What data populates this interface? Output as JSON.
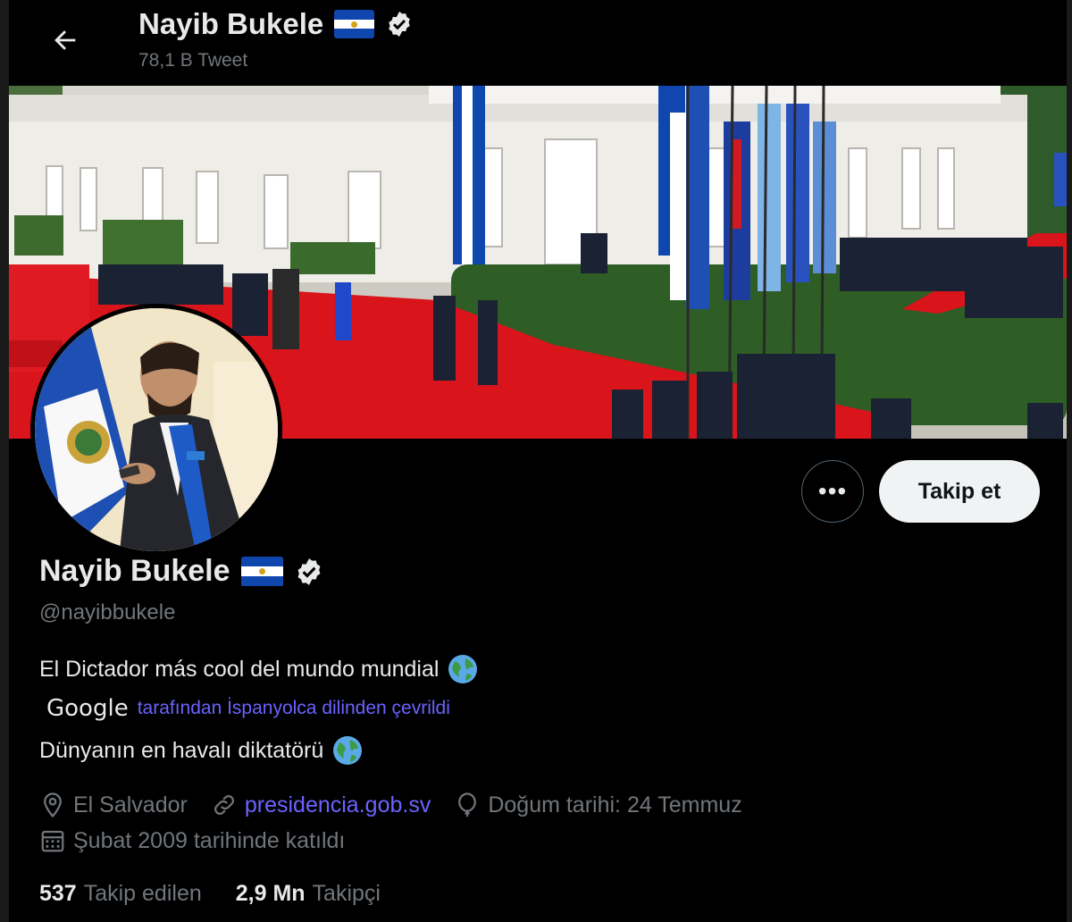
{
  "header": {
    "name": "Nayib Bukele",
    "tweet_count": "78,1 B Tweet"
  },
  "profile": {
    "name": "Nayib Bukele",
    "handle": "@nayibbukele",
    "bio": "El Dictador más cool del mundo mundial",
    "translation_brand": "Google",
    "translation_note": "tarafından İspanyolca dilinden çevrildi",
    "bio_translated": "Dünyanın en havalı diktatörü",
    "location": "El Salvador",
    "website": "presidencia.gob.sv",
    "birthday": "Doğum tarihi: 24 Temmuz",
    "joined": "Şubat 2009 tarihinde katıldı",
    "following_count": "537",
    "following_label": "Takip edilen",
    "followers_count": "2,9 Mn",
    "followers_label": "Takipçi"
  },
  "actions": {
    "more_label": "•••",
    "follow_label": "Takip et"
  },
  "colors": {
    "background": "#000000",
    "text_primary": "#e7e9ea",
    "text_secondary": "#71767b",
    "link": "#6b63ff",
    "follow_button_bg": "#eff3f4"
  },
  "icons": [
    "back-arrow-icon",
    "verified-badge-icon",
    "el-salvador-flag-icon",
    "globe-emoji-icon",
    "location-pin-icon",
    "link-icon",
    "balloon-icon",
    "calendar-icon"
  ]
}
